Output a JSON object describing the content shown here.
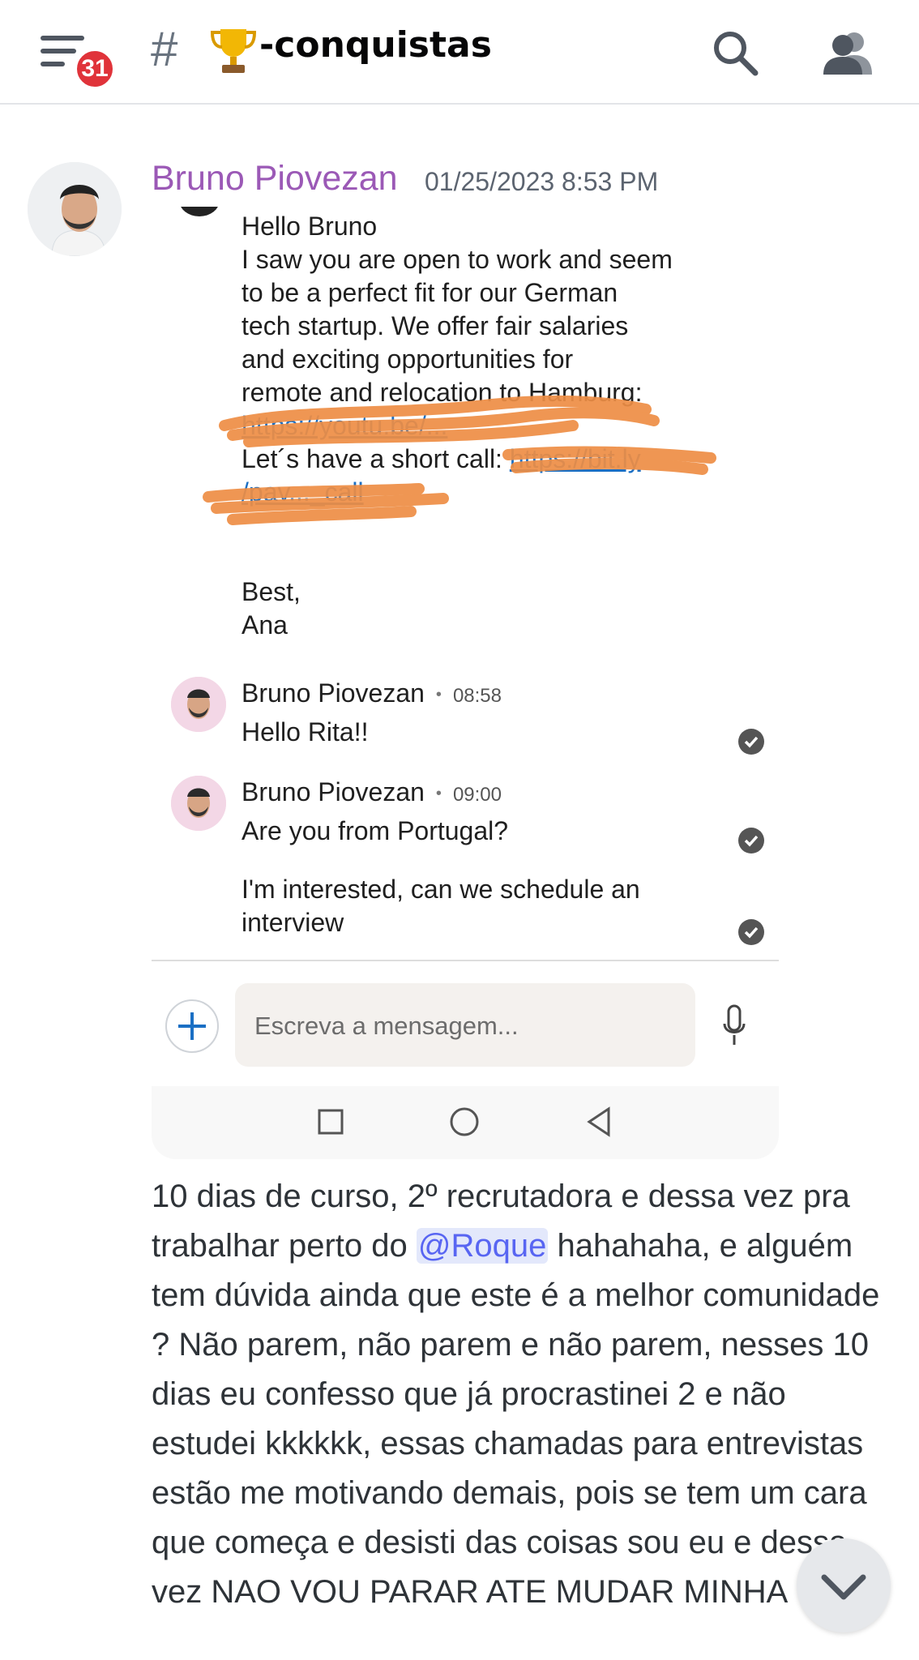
{
  "header": {
    "badge_count": "31",
    "channel_prefix": "#",
    "channel_name": "-conquistas",
    "icons": {
      "menu": "hamburger-menu-icon",
      "channel": "trophy-icon",
      "search": "search-icon",
      "members": "members-icon"
    }
  },
  "message": {
    "author": "Bruno Piovezan",
    "timestamp": "01/25/2023 8:53 PM",
    "author_color": "#9b59b6",
    "screenshot": {
      "greeting": "Hello Bruno",
      "body_lines": [
        "I saw you are open to work and seem",
        "to be a perfect fit for our German",
        "tech startup. We offer fair salaries",
        "and exciting opportunities for",
        "remote and relocation to Hamburg:"
      ],
      "link_1": "https://youtu.be/...",
      "call_prefix": "Let´s have a short call: ",
      "link_2": "https://bit.ly",
      "link_3": "/pav..._call",
      "signoff_1": "Best,",
      "signoff_2": "Ana",
      "replies": [
        {
          "name": "Bruno Piovezan",
          "time": "08:58",
          "lines": [
            "Hello Rita!!"
          ]
        },
        {
          "name": "Bruno Piovezan",
          "time": "09:00",
          "lines": [
            "Are you from Portugal?"
          ]
        }
      ],
      "extra_reply": [
        "I'm interested, can we schedule an",
        "interview"
      ],
      "composer_placeholder": "Escreva a mensagem..."
    },
    "text_part1": "10 dias de curso, 2º recrutadora e dessa vez pra trabalhar perto do ",
    "mention": "@Roque",
    "text_part2": " hahahaha, e alguém tem dúvida ainda que este é a melhor comunidade ? Não parem, não parem e não parem, nesses 10 dias eu confesso que já procrastinei 2 e não estudei kkkkkk, essas chamadas para entrevistas estão me motivando demais, pois se tem um cara que começa e desisti das coisas sou eu e dessa vez NAO VOU PARAR ATE MUDAR MINHA"
  },
  "colors": {
    "accent": "#5865f2",
    "badge": "#e0333a",
    "mention_bg": "#e3e8fb"
  }
}
